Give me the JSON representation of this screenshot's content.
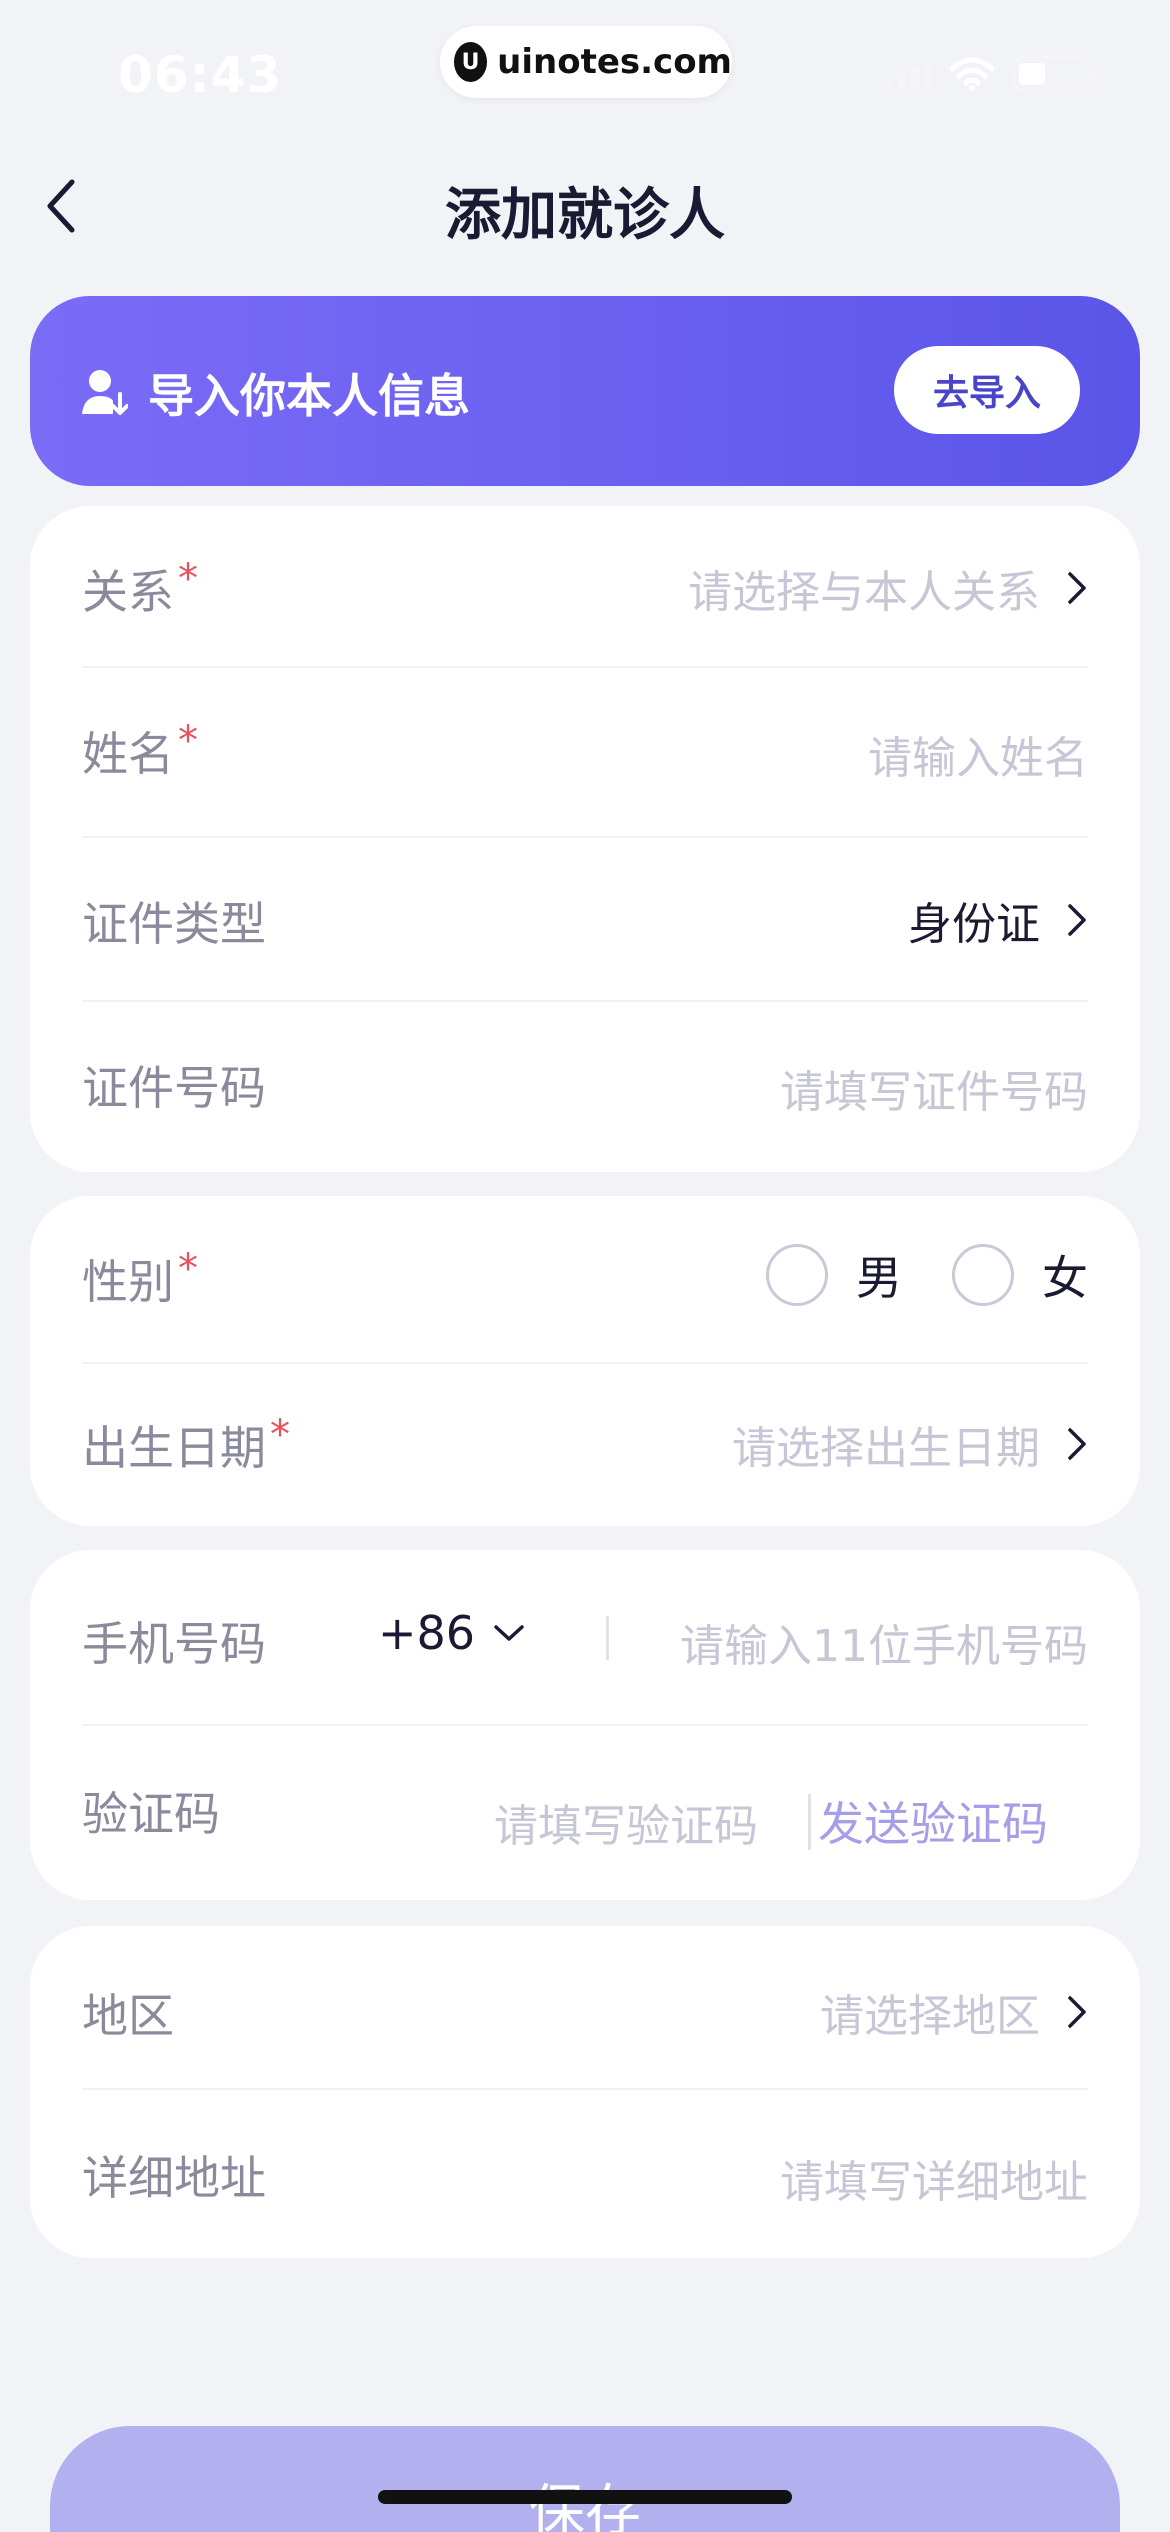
{
  "status_bar": {
    "time": "06:43",
    "watermark": "uinotes.com",
    "battery_level_percent": 40
  },
  "nav": {
    "title": "添加就诊人",
    "back_icon": "chevron-left-icon"
  },
  "banner": {
    "text": "导入你本人信息",
    "button_label": "去导入",
    "icon": "user-import-icon"
  },
  "card1": {
    "relation": {
      "label": "关系",
      "required": "*",
      "placeholder": "请选择与本人关系"
    },
    "name": {
      "label": "姓名",
      "required": "*",
      "placeholder": "请输入姓名"
    },
    "id_type": {
      "label": "证件类型",
      "value": "身份证"
    },
    "id_number": {
      "label": "证件号码",
      "placeholder": "请填写证件号码"
    }
  },
  "card2": {
    "gender": {
      "label": "性别",
      "required": "*",
      "options": [
        "男",
        "女"
      ]
    },
    "birthday": {
      "label": "出生日期",
      "required": "*",
      "placeholder": "请选择出生日期"
    }
  },
  "card3": {
    "phone": {
      "label": "手机号码",
      "country_code": "+86",
      "placeholder": "请输入11位手机号码"
    },
    "verify": {
      "label": "验证码",
      "placeholder": "请填写验证码",
      "send_label": "发送验证码"
    }
  },
  "card4": {
    "region": {
      "label": "地区",
      "placeholder": "请选择地区"
    },
    "address": {
      "label": "详细地址",
      "placeholder": "请填写详细地址"
    }
  },
  "save_button": {
    "label": "保存"
  },
  "colors": {
    "accent": "#6a5ff0",
    "required": "#e8505b",
    "placeholder": "#c6c6d6",
    "save": "#b3b0ef"
  }
}
